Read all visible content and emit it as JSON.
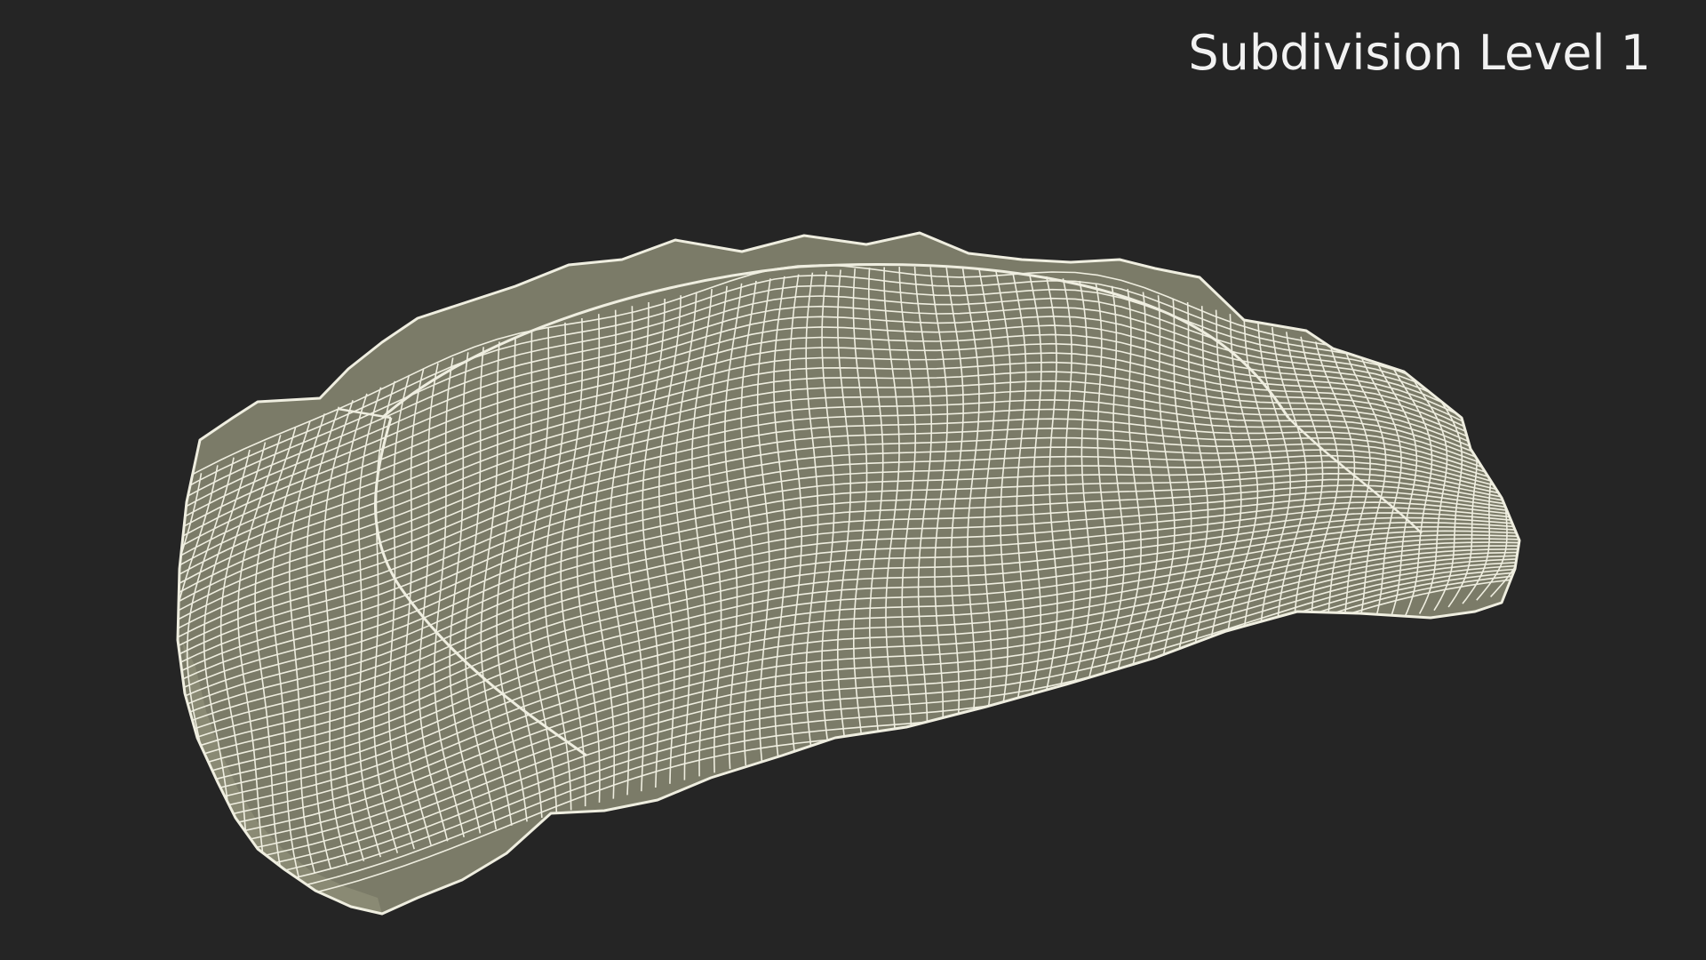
{
  "viewport": {
    "background_color": "#252525",
    "label": "Subdivision Level 1"
  },
  "model": {
    "display": "wireframe",
    "surface_color": "#7b7b68",
    "wire_color": "#efeee0"
  }
}
